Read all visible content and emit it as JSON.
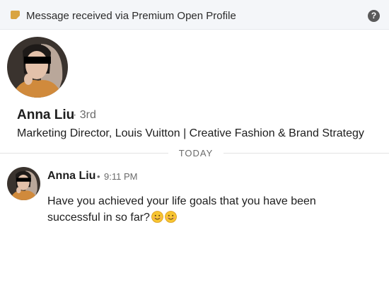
{
  "banner": {
    "text": "Message received via Premium Open Profile",
    "icon": "premium-square-icon",
    "help_icon": "question-circle-icon",
    "help_glyph": "?"
  },
  "profile": {
    "name": "Anna Liu",
    "degree": "· 3rd",
    "headline": "Marketing Director, Louis Vuitton | Creative Fashion & Brand Strategy"
  },
  "divider": {
    "label": "TODAY"
  },
  "message": {
    "sender": "Anna Liu",
    "separator": "•",
    "time": "9:11 PM",
    "text": "Have you achieved your life goals that you have been successful in so far?",
    "emojis": [
      "smiling-face-emoji",
      "smiling-face-emoji"
    ]
  },
  "colors": {
    "banner_bg": "#f4f6f9",
    "premium_gold": "#d9a441",
    "text_primary": "#1d1d1d",
    "text_secondary": "#6b6b6b"
  }
}
